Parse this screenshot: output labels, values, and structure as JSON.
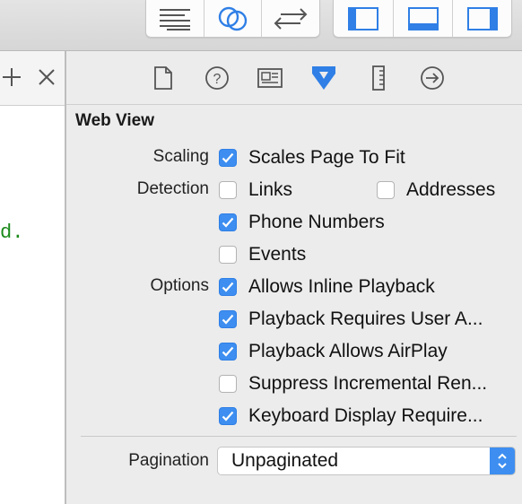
{
  "toolbar": {
    "editor_buttons": [
      {
        "icon": "standard-editor-icon"
      },
      {
        "icon": "assistant-editor-icon"
      },
      {
        "icon": "version-editor-icon"
      }
    ],
    "view_buttons": [
      {
        "icon": "navigator-toggle-icon"
      },
      {
        "icon": "debug-area-toggle-icon"
      },
      {
        "icon": "utilities-toggle-icon"
      }
    ]
  },
  "editor": {
    "add_symbol": "+",
    "close_symbol": "×",
    "code_fragment": "d."
  },
  "inspector": {
    "tabs": [
      {
        "icon": "file-inspector-icon"
      },
      {
        "icon": "quick-help-icon"
      },
      {
        "icon": "identity-inspector-icon"
      },
      {
        "icon": "attributes-inspector-icon",
        "selected": true
      },
      {
        "icon": "size-inspector-icon"
      },
      {
        "icon": "connections-inspector-icon"
      }
    ],
    "section_title": "Web View",
    "labels": {
      "scaling": "Scaling",
      "detection": "Detection",
      "options": "Options",
      "pagination": "Pagination"
    },
    "scaling": {
      "label": "Scales Page To Fit",
      "checked": true
    },
    "detection": [
      {
        "label": "Links",
        "checked": false
      },
      {
        "label": "Addresses",
        "checked": false
      },
      {
        "label": "Phone Numbers",
        "checked": true
      },
      {
        "label": "Events",
        "checked": false
      }
    ],
    "options": [
      {
        "label": "Allows Inline Playback",
        "checked": true
      },
      {
        "label": "Playback Requires User A...",
        "checked": true
      },
      {
        "label": "Playback Allows AirPlay",
        "checked": true
      },
      {
        "label": "Suppress Incremental Ren...",
        "checked": false
      },
      {
        "label": "Keyboard Display Require...",
        "checked": true
      }
    ],
    "pagination": {
      "value": "Unpaginated"
    }
  },
  "colors": {
    "accent": "#3d8ef0",
    "code_green": "#1b8a1b"
  }
}
